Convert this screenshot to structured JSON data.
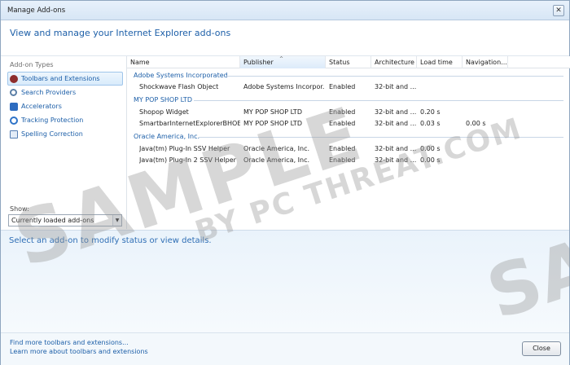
{
  "window": {
    "title": "Manage Add-ons",
    "close_glyph": "✕"
  },
  "header": {
    "text": "View and manage your Internet Explorer add-ons"
  },
  "sidebar": {
    "section_label": "Add-on Types",
    "items": [
      {
        "label": "Toolbars and Extensions",
        "icon": "toolbar-icon",
        "selected": true
      },
      {
        "label": "Search Providers",
        "icon": "search-icon",
        "selected": false
      },
      {
        "label": "Accelerators",
        "icon": "accelerator-icon",
        "selected": false
      },
      {
        "label": "Tracking Protection",
        "icon": "tracking-protection-icon",
        "selected": false
      },
      {
        "label": "Spelling Correction",
        "icon": "spelling-icon",
        "selected": false
      }
    ],
    "show_label": "Show:",
    "show_value": "Currently loaded add-ons",
    "dropdown_arrow": "▼"
  },
  "table": {
    "columns": [
      "Name",
      "Publisher",
      "Status",
      "Architecture",
      "Load time",
      "Navigation..."
    ],
    "sort_glyph": "^",
    "groups": [
      {
        "name": "Adobe Systems Incorporated",
        "rows": [
          {
            "name": "Shockwave Flash Object",
            "publisher": "Adobe Systems Incorpor...",
            "status": "Enabled",
            "architecture": "32-bit and ...",
            "load_time": "",
            "navigation": ""
          }
        ]
      },
      {
        "name": "MY POP SHOP LTD",
        "rows": [
          {
            "name": "Shopop Widget",
            "publisher": "MY POP SHOP LTD",
            "status": "Enabled",
            "architecture": "32-bit and ...",
            "load_time": "0.20 s",
            "navigation": ""
          },
          {
            "name": "SmartbarInternetExplorerBHOE...",
            "publisher": "MY POP SHOP LTD",
            "status": "Enabled",
            "architecture": "32-bit and ...",
            "load_time": "0.03 s",
            "navigation": "0.00 s"
          }
        ]
      },
      {
        "name": "Oracle America, Inc.",
        "rows": [
          {
            "name": "Java(tm) Plug-In SSV Helper",
            "publisher": "Oracle America, Inc.",
            "status": "Enabled",
            "architecture": "32-bit and ...",
            "load_time": "0.00 s",
            "navigation": ""
          },
          {
            "name": "Java(tm) Plug-In 2 SSV Helper",
            "publisher": "Oracle America, Inc.",
            "status": "Enabled",
            "architecture": "32-bit and ...",
            "load_time": "0.00 s",
            "navigation": ""
          }
        ]
      }
    ]
  },
  "details": {
    "text": "Select an add-on to modify status or view details."
  },
  "footer": {
    "link1": "Find more toolbars and extensions...",
    "link2": "Learn more about toolbars and extensions",
    "close_label": "Close"
  },
  "watermark": {
    "sample": "SAMPLE",
    "by": "BY PC THREAT.COM",
    "fragment": "SA"
  }
}
